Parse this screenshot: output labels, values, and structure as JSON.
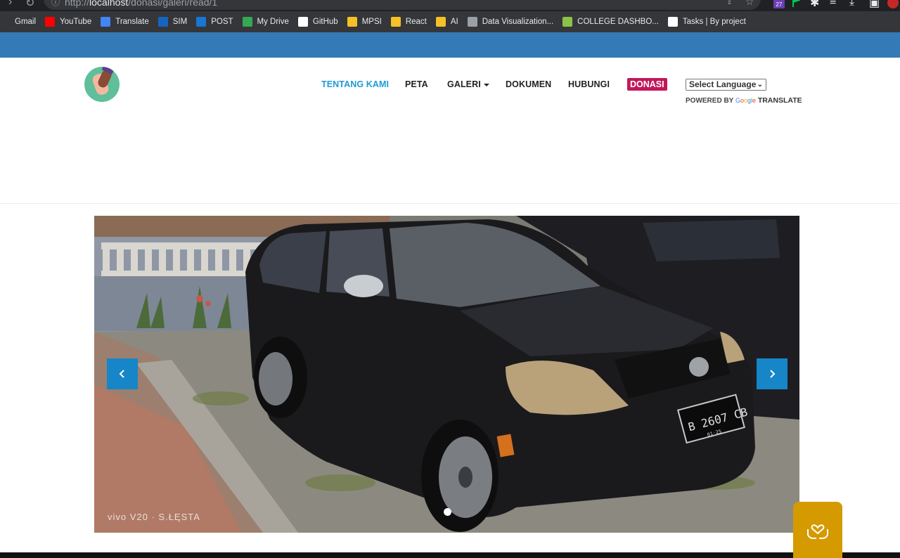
{
  "browser": {
    "url_prefix": "http://",
    "url_host": "localhost",
    "url_path": "/donasi/galeri/read/1",
    "badge_count": "27",
    "bookmarks": [
      {
        "label": "Gmail",
        "icon": "gmail-icon",
        "color": "#35363a"
      },
      {
        "label": "YouTube",
        "icon": "youtube-icon",
        "color": "#ff0000"
      },
      {
        "label": "Translate",
        "icon": "translate-icon",
        "color": "#4285f4"
      },
      {
        "label": "SIM",
        "icon": "sim-icon",
        "color": "#1565c0"
      },
      {
        "label": "POST",
        "icon": "post-icon",
        "color": "#1976d2"
      },
      {
        "label": "My Drive",
        "icon": "drive-icon",
        "color": "#34a853"
      },
      {
        "label": "GitHub",
        "icon": "github-icon",
        "color": "#ffffff"
      },
      {
        "label": "MPSI",
        "icon": "folder-icon",
        "color": "#f6c026"
      },
      {
        "label": "React",
        "icon": "folder-icon",
        "color": "#f6c026"
      },
      {
        "label": "AI",
        "icon": "folder-icon",
        "color": "#f6c026"
      },
      {
        "label": "Data Visualization...",
        "icon": "globe-icon",
        "color": "#9aa0a6"
      },
      {
        "label": "COLLEGE DASHBO...",
        "icon": "dashboard-icon",
        "color": "#8bc34a"
      },
      {
        "label": "Tasks | By project",
        "icon": "notion-icon",
        "color": "#ffffff"
      }
    ]
  },
  "nav": {
    "items": [
      {
        "label": "TENTANG KAMI",
        "active": true
      },
      {
        "label": "PETA",
        "active": false
      },
      {
        "label": "GALERI",
        "active": false,
        "dropdown": true
      },
      {
        "label": "DOKUMEN",
        "active": false
      },
      {
        "label": "HUBUNGI",
        "active": false
      }
    ],
    "donate_label": "DONASI",
    "donate_color": "#c2185b",
    "active_color": "#1e9ad6"
  },
  "translate": {
    "select_label": "Select Language",
    "powered_by": "POWERED BY",
    "google": [
      "G",
      "o",
      "o",
      "g",
      "l",
      "e"
    ],
    "translate": "TRANSLATE"
  },
  "carousel": {
    "watermark": "vivo V20 · S.ŁĘSTA",
    "plate_line1": "B 2607 CB",
    "plate_line2": "01·25",
    "slide_count": 1,
    "active_slide": 1,
    "control_color": "#1786c8"
  },
  "help_button": {
    "icon": "hands-heart-icon",
    "color": "#d49a00"
  },
  "accent_strip_color": "#337ab7"
}
